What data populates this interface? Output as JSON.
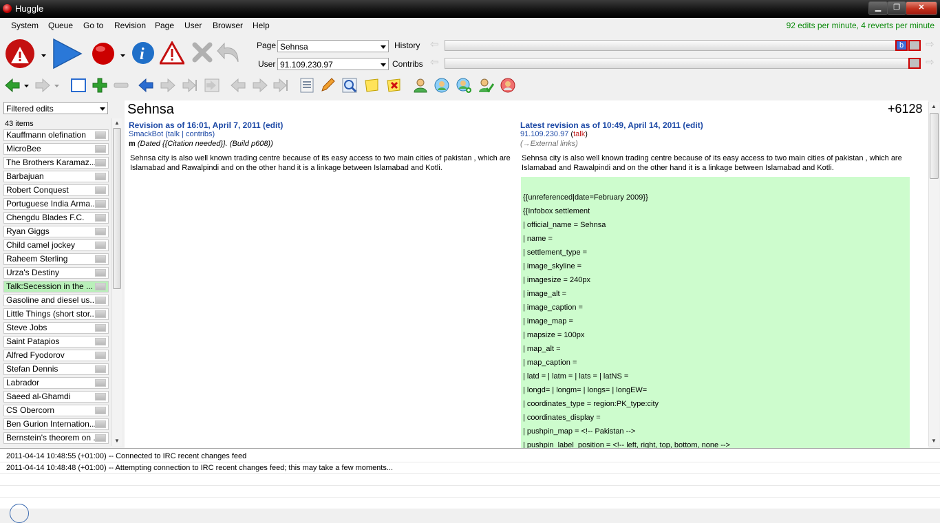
{
  "window": {
    "title": "Huggle",
    "min_label": "▁",
    "max_label": "❐",
    "close_label": "✕"
  },
  "menu": [
    "System",
    "Queue",
    "Go to",
    "Revision",
    "Page",
    "User",
    "Browser",
    "Help"
  ],
  "rate": "92 edits per minute, 4 reverts per minute",
  "toolbar": {
    "page_label": "Page",
    "page_value": "Sehnsa",
    "user_label": "User",
    "user_value": "91.109.230.97",
    "history_label": "History",
    "contribs_label": "Contribs",
    "history_marker": "b"
  },
  "icons_big": [
    "warning-revert-icon",
    "next-icon",
    "record-icon",
    "info-icon",
    "warn-icon",
    "cancel-icon",
    "undo-icon"
  ],
  "icons_small": [
    "back-icon",
    "forward-icon",
    "select-icon",
    "add-icon",
    "remove-icon",
    "prev-edit-icon",
    "next-edit-icon",
    "next-edit-2-icon",
    "next-edit-3-icon",
    "prev-user-edit-icon",
    "next-user-edit-icon",
    "latest-edit-icon",
    "page-history-icon",
    "edit-pencil-icon",
    "search-icon",
    "note-icon",
    "delete-icon",
    "user-icon",
    "talk-icon",
    "user-info-icon",
    "whitelist-icon",
    "block-icon"
  ],
  "queue": {
    "filter": "Filtered edits",
    "count": "43 items",
    "items": [
      "Kauffmann olefination",
      "MicroBee",
      "The Brothers Karamaz...",
      "Barbajuan",
      "Robert Conquest",
      "Portuguese India Arma...",
      "Chengdu Blades F.C.",
      "Ryan Giggs",
      "Child camel jockey",
      "Raheem Sterling",
      "Urza's Destiny",
      "Talk:Secession in the ...",
      "Gasoline and diesel us...",
      "Little Things (short stor...",
      "Steve Jobs",
      "Saint Patapios",
      "Alfred Fyodorov",
      "Stefan Dennis",
      "Labrador",
      "Saeed al-Ghamdi",
      "CS Obercorn",
      "Ben Gurion Internation...",
      "Bernstein's theorem on ..."
    ],
    "selected_index": 11
  },
  "diff": {
    "title": "Sehnsa",
    "size_change": "+6128",
    "old": {
      "header": "Revision as of 16:01, April 7, 2011",
      "edit": "edit",
      "user": "SmackBot",
      "talk": "talk",
      "contribs": "contribs",
      "minor": "m",
      "summary": "(Dated {{Citation needed}}. (Build p608))",
      "text": "Sehnsa city is also well known trading centre because of its easy access to two main cities of pakistan , which are Islamabad and Rawalpindi and on the other hand it is a linkage between Islamabad and Kotli."
    },
    "new": {
      "header": "Latest revision as of 10:49, April 14, 2011",
      "edit": "edit",
      "user": "91.109.230.97",
      "talk": "talk",
      "summary": "(→External links)",
      "text": "Sehnsa city is also well known trading centre because of its easy access to two main cities of pakistan , which are Islamabad and Rawalpindi and on the other hand it is a linkage between Islamabad and Kotli."
    },
    "added_lines": [
      "",
      "{{unreferenced|date=February 2009}}",
      "{{Infobox settlement",
      "| official_name = Sehnsa",
      "| name =",
      "| settlement_type =",
      "| image_skyline =",
      "| imagesize = 240px",
      "| image_alt =",
      "| image_caption =",
      "| image_map =",
      "| mapsize = 100px",
      "| map_alt =",
      "| map_caption =",
      "| latd = | latm = | lats = | latNS =",
      "| longd= | longm= | longs= | longEW=",
      "| coordinates_type = region:PK_type:city",
      "| coordinates_display =",
      "| pushpin_map = <!-- Pakistan -->",
      "| pushpin_label_position = <!-- left, right, top, bottom, none -->"
    ]
  },
  "log": [
    "2011-04-14 10:48:55 (+01:00) -- Connected to IRC recent changes feed",
    "2011-04-14 10:48:48 (+01:00) -- Attempting connection to IRC recent changes feed; this may take a few moments..."
  ]
}
